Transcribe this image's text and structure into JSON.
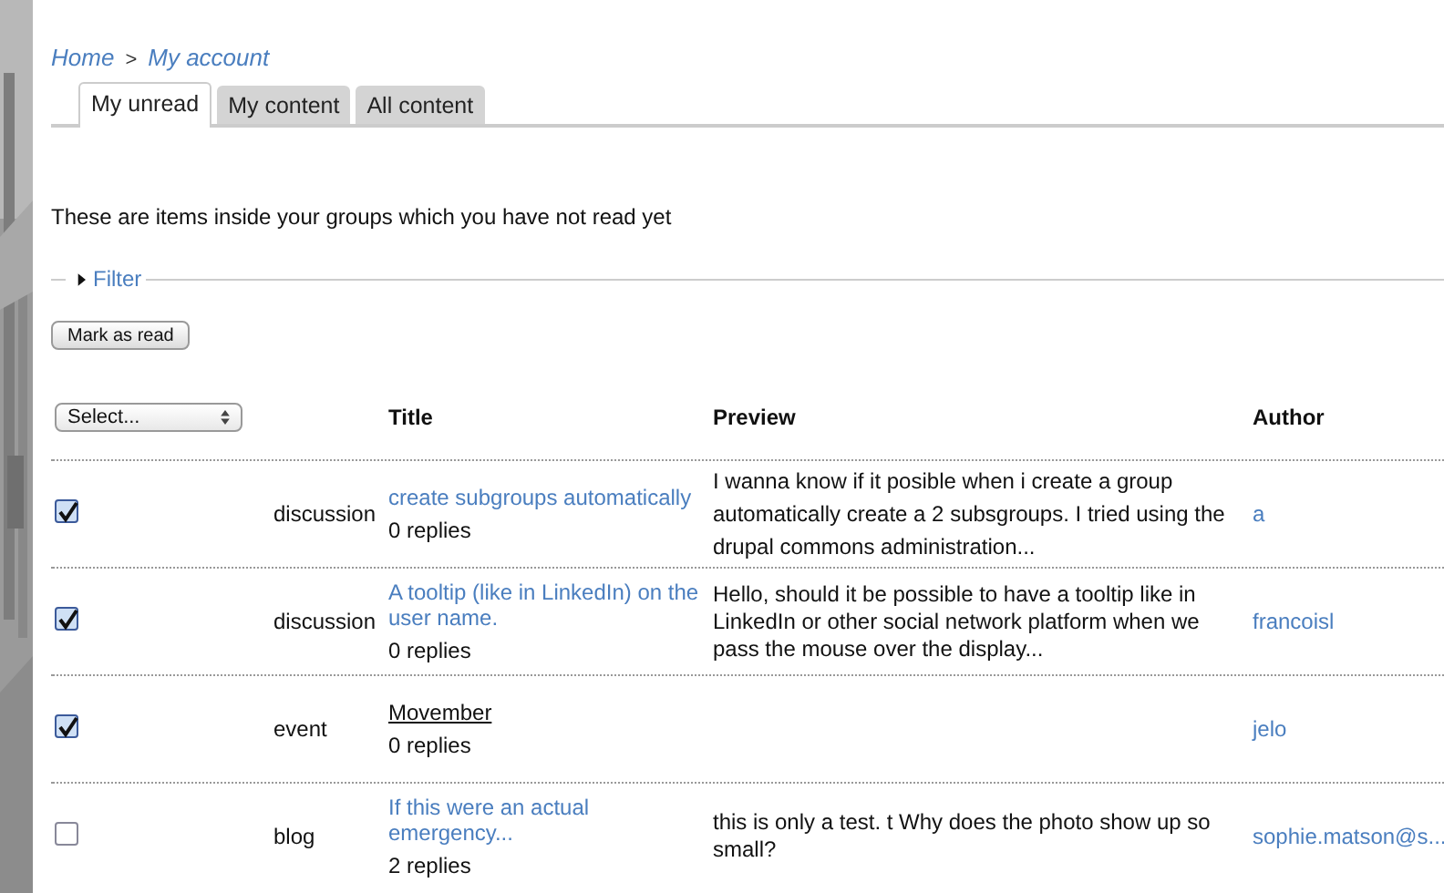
{
  "breadcrumb": [
    {
      "label": "Home"
    },
    {
      "label": "My account"
    }
  ],
  "breadcrumb_separator": ">",
  "tabs": [
    {
      "label": "My unread",
      "selected": true
    },
    {
      "label": "My content",
      "selected": false
    },
    {
      "label": "All content",
      "selected": false
    }
  ],
  "intro": "These are items inside your groups which you have not read yet",
  "filter": {
    "label": "Filter",
    "expanded": false
  },
  "mark_button": "Mark as read",
  "table": {
    "select": {
      "value": "Select..."
    },
    "columns": [
      "Title",
      "Preview",
      "Author"
    ],
    "rows": [
      {
        "checked": true,
        "type": "discussion",
        "title": "create subgroups automatically",
        "hovered": false,
        "replies": "0 replies",
        "preview": "I wanna know if it posible when i create a group automatically create a 2 subsgroups. I tried using the drupal commons administration...",
        "author": "a"
      },
      {
        "checked": true,
        "type": "discussion",
        "title": "A tooltip (like in LinkedIn) on the user name.",
        "hovered": false,
        "replies": "0 replies",
        "preview": "Hello, should it be possible to have a tooltip like in LinkedIn or other social network platform when we pass the mouse over the display...",
        "author": "francoisl"
      },
      {
        "checked": true,
        "type": "event",
        "title": "Movember",
        "hovered": true,
        "replies": "0 replies",
        "preview": "",
        "author": "jelo"
      },
      {
        "checked": false,
        "type": "blog",
        "title": "If this were an actual emergency...",
        "hovered": false,
        "replies": "2 replies",
        "preview": "this is only a test.   t   Why does the photo show up so small?",
        "author": "sophie.matson@s..."
      }
    ]
  }
}
